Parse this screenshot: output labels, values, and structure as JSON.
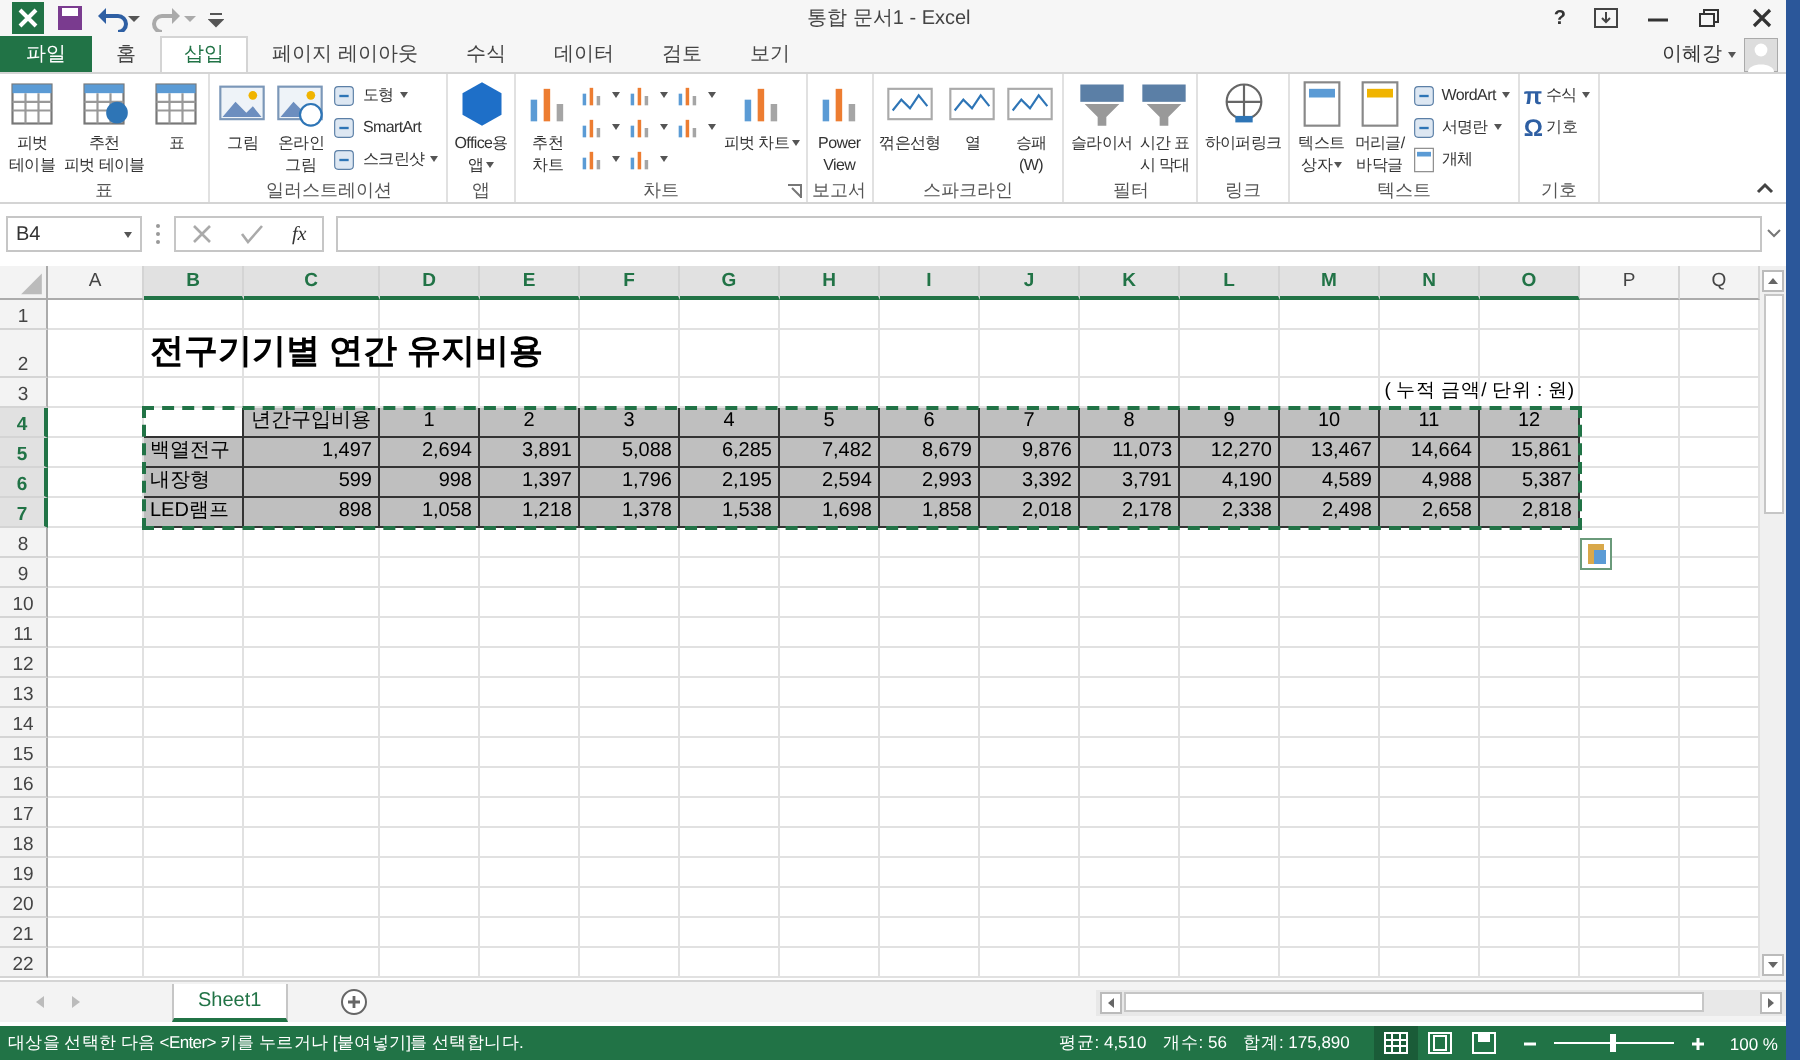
{
  "window": {
    "title": "통합 문서1 - Excel",
    "help": "?",
    "user": "이혜강"
  },
  "tabs": [
    {
      "label": "파일",
      "kind": "file",
      "selected": false
    },
    {
      "label": "홈",
      "kind": "tab",
      "selected": false
    },
    {
      "label": "삽입",
      "kind": "tab",
      "selected": true
    },
    {
      "label": "페이지 레이아웃",
      "kind": "tab",
      "selected": false
    },
    {
      "label": "수식",
      "kind": "tab",
      "selected": false
    },
    {
      "label": "데이터",
      "kind": "tab",
      "selected": false
    },
    {
      "label": "검토",
      "kind": "tab",
      "selected": false
    },
    {
      "label": "보기",
      "kind": "tab",
      "selected": false
    }
  ],
  "ribbon": [
    {
      "label": "표",
      "items": [
        {
          "kind": "large",
          "label": "피벗\n테이블",
          "dropdown": false
        },
        {
          "kind": "large",
          "label": "추천\n피벗 테이블",
          "dropdown": false
        },
        {
          "kind": "large",
          "label": "표",
          "dropdown": false
        }
      ]
    },
    {
      "label": "일러스트레이션",
      "items": [
        {
          "kind": "large",
          "label": "그림",
          "dropdown": false
        },
        {
          "kind": "large",
          "label": "온라인\n그림",
          "dropdown": false
        },
        {
          "kind": "small",
          "label": "도형",
          "dropdown": true
        },
        {
          "kind": "small",
          "label": "SmartArt",
          "dropdown": false
        },
        {
          "kind": "small",
          "label": "스크린샷",
          "dropdown": true
        }
      ]
    },
    {
      "label": "앱",
      "items": [
        {
          "kind": "large",
          "label": "Office용\n앱",
          "dropdown": true
        }
      ]
    },
    {
      "label": "차트",
      "launcher": true,
      "items": [
        {
          "kind": "large",
          "label": "추천\n차트",
          "dropdown": false
        },
        {
          "kind": "icon",
          "dropdown": true
        },
        {
          "kind": "icon",
          "dropdown": true
        },
        {
          "kind": "icon",
          "dropdown": true
        },
        {
          "kind": "icon",
          "dropdown": true
        },
        {
          "kind": "icon",
          "dropdown": true
        },
        {
          "kind": "icon",
          "dropdown": true
        },
        {
          "kind": "icon",
          "dropdown": true
        },
        {
          "kind": "icon",
          "dropdown": true
        },
        {
          "kind": "large",
          "label": "피벗 차트",
          "dropdown": true
        }
      ]
    },
    {
      "label": "보고서",
      "items": [
        {
          "kind": "large",
          "label": "Power\nView",
          "dropdown": false
        }
      ]
    },
    {
      "label": "스파크라인",
      "items": [
        {
          "kind": "large",
          "label": "꺾은선형",
          "dropdown": false
        },
        {
          "kind": "large",
          "label": "열",
          "dropdown": false
        },
        {
          "kind": "large",
          "label": "승패\n(W)",
          "dropdown": false
        }
      ]
    },
    {
      "label": "필터",
      "items": [
        {
          "kind": "large",
          "label": "슬라이서",
          "dropdown": false
        },
        {
          "kind": "large",
          "label": "시간 표\n시 막대",
          "dropdown": false
        }
      ]
    },
    {
      "label": "링크",
      "items": [
        {
          "kind": "large",
          "label": "하이퍼링크",
          "dropdown": false
        }
      ]
    },
    {
      "label": "텍스트",
      "items": [
        {
          "kind": "large",
          "label": "텍스트\n상자",
          "dropdown": true
        },
        {
          "kind": "large",
          "label": "머리글/\n바닥글",
          "dropdown": false
        },
        {
          "kind": "small",
          "label": "WordArt",
          "dropdown": true
        },
        {
          "kind": "small",
          "label": "서명란",
          "dropdown": true
        },
        {
          "kind": "small",
          "label": "개체",
          "dropdown": false
        }
      ]
    },
    {
      "label": "기호",
      "items": [
        {
          "kind": "symbol",
          "symbol": "π",
          "label": "수식",
          "dropdown": true
        },
        {
          "kind": "symbol",
          "symbol": "Ω",
          "label": "기호",
          "dropdown": false
        }
      ]
    }
  ],
  "formula_bar": {
    "name_box": "B4",
    "function_label": "fx"
  },
  "sheet": {
    "columns": [
      {
        "label": "A",
        "selected": false
      },
      {
        "label": "B",
        "selected": true
      },
      {
        "label": "C",
        "selected": true
      },
      {
        "label": "D",
        "selected": true
      },
      {
        "label": "E",
        "selected": true
      },
      {
        "label": "F",
        "selected": true
      },
      {
        "label": "G",
        "selected": true
      },
      {
        "label": "H",
        "selected": true
      },
      {
        "label": "I",
        "selected": true
      },
      {
        "label": "J",
        "selected": true
      },
      {
        "label": "K",
        "selected": true
      },
      {
        "label": "L",
        "selected": true
      },
      {
        "label": "M",
        "selected": true
      },
      {
        "label": "N",
        "selected": true
      },
      {
        "label": "O",
        "selected": true
      },
      {
        "label": "P",
        "selected": false
      },
      {
        "label": "Q",
        "selected": false
      }
    ],
    "rows": [
      {
        "label": "1",
        "selected": false
      },
      {
        "label": "2",
        "selected": false
      },
      {
        "label": "3",
        "selected": false
      },
      {
        "label": "4",
        "selected": true
      },
      {
        "label": "5",
        "selected": true
      },
      {
        "label": "6",
        "selected": true
      },
      {
        "label": "7",
        "selected": true
      },
      {
        "label": "8",
        "selected": false
      },
      {
        "label": "9",
        "selected": false
      },
      {
        "label": "10",
        "selected": false
      },
      {
        "label": "11",
        "selected": false
      },
      {
        "label": "12",
        "selected": false
      },
      {
        "label": "13",
        "selected": false
      },
      {
        "label": "14",
        "selected": false
      },
      {
        "label": "15",
        "selected": false
      },
      {
        "label": "16",
        "selected": false
      },
      {
        "label": "17",
        "selected": false
      },
      {
        "label": "18",
        "selected": false
      },
      {
        "label": "19",
        "selected": false
      },
      {
        "label": "20",
        "selected": false
      },
      {
        "label": "21",
        "selected": false
      },
      {
        "label": "22",
        "selected": false
      }
    ],
    "title": "전구기기별 연간 유지비용",
    "note": "( 누적 금액/ 단위 : 원)",
    "table": {
      "header": [
        "년간구입비용",
        "1",
        "2",
        "3",
        "4",
        "5",
        "6",
        "7",
        "8",
        "9",
        "10",
        "11",
        "12"
      ],
      "rows": [
        [
          "백열전구",
          "1,497",
          "2,694",
          "3,891",
          "5,088",
          "6,285",
          "7,482",
          "8,679",
          "9,876",
          "11,073",
          "12,270",
          "13,467",
          "14,664",
          "15,861"
        ],
        [
          "내장형",
          "599",
          "998",
          "1,397",
          "1,796",
          "2,195",
          "2,594",
          "2,993",
          "3,392",
          "3,791",
          "4,190",
          "4,589",
          "4,988",
          "5,387"
        ],
        [
          "LED램프",
          "898",
          "1,058",
          "1,218",
          "1,378",
          "1,538",
          "1,698",
          "1,858",
          "2,018",
          "2,178",
          "2,338",
          "2,498",
          "2,658",
          "2,818"
        ]
      ]
    }
  },
  "sheet_tabs": [
    {
      "label": "Sheet1",
      "selected": true
    }
  ],
  "status_bar": {
    "message": "대상을 선택한 다음 <Enter> 키를 누르거나 [붙여넣기]를 선택합니다.",
    "average": "평균: 4,510",
    "count": "개수: 56",
    "sum": "합계: 175,890",
    "views": [
      {
        "selected": true
      },
      {
        "selected": false
      },
      {
        "selected": false
      }
    ],
    "zoom_slider": {
      "level": 0.5
    },
    "zoom": "100 %"
  }
}
